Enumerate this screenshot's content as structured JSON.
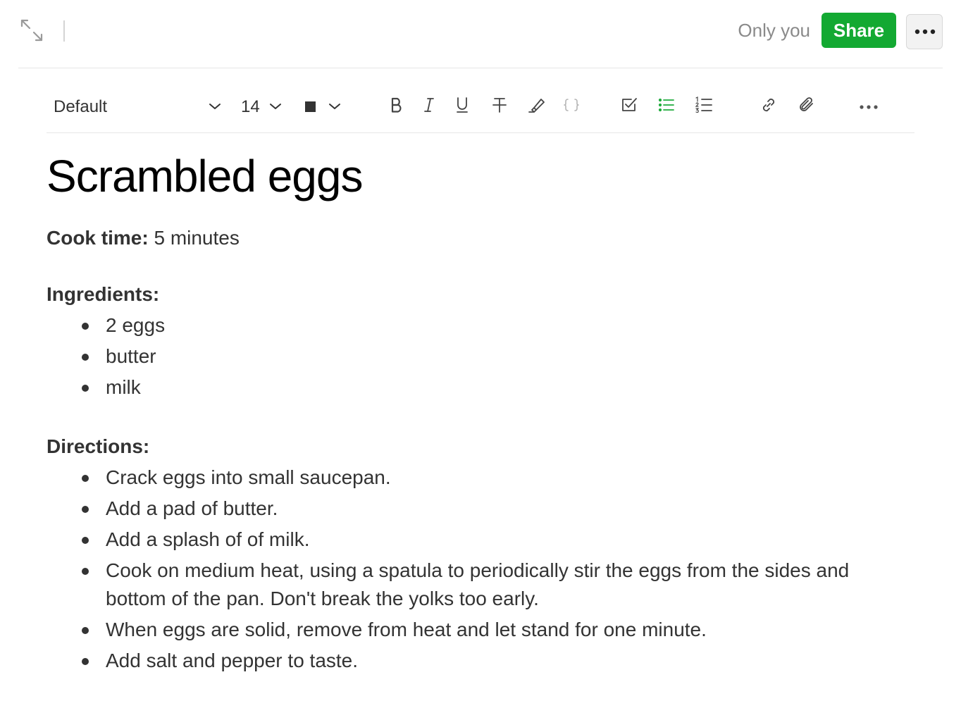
{
  "topbar": {
    "share_status": "Only you",
    "share_label": "Share",
    "more_icon": "more-horizontal-icon",
    "expand_icon": "expand-icon",
    "share_color": "#13a932"
  },
  "toolbar": {
    "font_family": "Default",
    "font_size": "14",
    "text_color": "#333333",
    "icons": [
      "bold-icon",
      "italic-icon",
      "underline-icon",
      "strikethrough-icon",
      "highlighter-icon",
      "code-block-icon",
      "checklist-icon",
      "bulleted-list-icon",
      "numbered-list-icon",
      "link-icon",
      "attachment-icon",
      "more-horizontal-icon"
    ]
  },
  "note": {
    "title": "Scrambled eggs",
    "cook_time_label": "Cook time:",
    "cook_time_value": " 5 minutes",
    "ingredients_heading": "Ingredients:",
    "ingredients": [
      "2 eggs",
      "butter",
      "milk"
    ],
    "directions_heading": "Directions:",
    "directions": [
      "Crack eggs into small saucepan.",
      "Add a pad of butter.",
      "Add a splash of of milk.",
      "Cook on medium heat, using a spatula to periodically stir the eggs from the sides and bottom of the pan. Don't break the yolks too early.",
      "When eggs are solid, remove from heat and let stand for one minute.",
      "Add salt and pepper to taste."
    ]
  }
}
